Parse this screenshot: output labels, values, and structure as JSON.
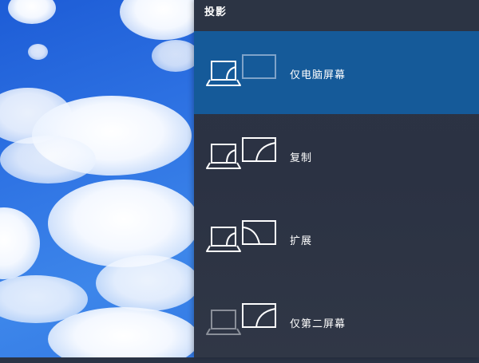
{
  "panel": {
    "title": "投影"
  },
  "options": [
    {
      "label": "仅电脑屏幕",
      "icon": "pc-screen-only-icon",
      "selected": true
    },
    {
      "label": "复制",
      "icon": "duplicate-icon",
      "selected": false
    },
    {
      "label": "扩展",
      "icon": "extend-icon",
      "selected": false
    },
    {
      "label": "仅第二屏幕",
      "icon": "second-screen-only-icon",
      "selected": false
    }
  ],
  "colors": {
    "panel_background": "#2b3243",
    "selected_background": "#155a99",
    "active_stroke": "#ffffff",
    "dim_stroke_selected": "#7fa3c9",
    "dim_stroke": "#8a8f99"
  }
}
